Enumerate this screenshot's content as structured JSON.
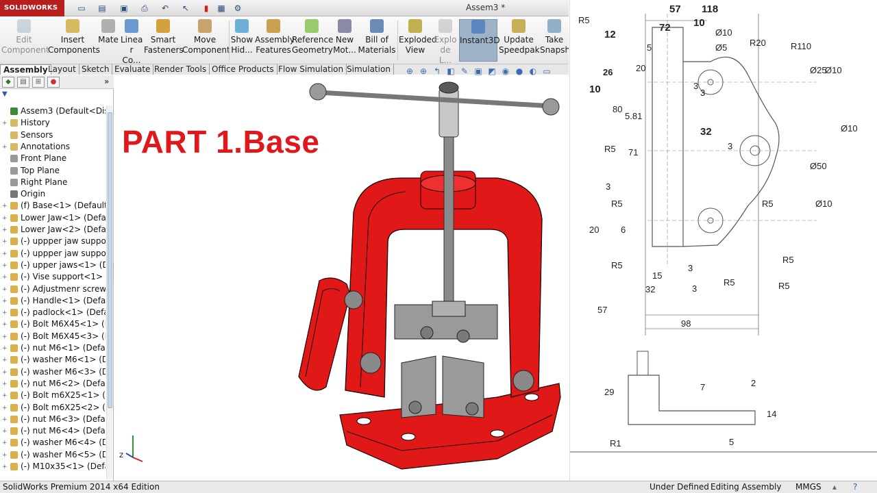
{
  "app": {
    "logo": "SOLIDWORKS",
    "doc_title": "Assem3 *"
  },
  "ribbon": {
    "edit_component": "Edit\nComponent",
    "insert_components": "Insert\nComponents",
    "mate": "Mate",
    "linear": "Linea\nr Co...",
    "smart_fasteners": "Smart\nFasteners",
    "move_component": "Move\nComponent",
    "show_hidden": "Show\nHid...",
    "assembly_features": "Assembly\nFeatures",
    "reference_geometry": "Reference\nGeometry",
    "new_motion": "New\nMot...",
    "bill_of_materials": "Bill of\nMaterials",
    "exploded_view": "Exploded\nView",
    "explode_line": "Explo\nde L...",
    "instant3d": "Instant3D",
    "update_speedpak": "Update\nSpeedpak",
    "take_snapshot": "Take\nSnapsho"
  },
  "tabs": [
    "Assembly",
    "Layout",
    "Sketch",
    "Evaluate",
    "Render Tools",
    "Office Products",
    "Flow Simulation",
    "Simulation"
  ],
  "tree": [
    {
      "label": "Assem3  (Default<Display",
      "expander": ""
    },
    {
      "label": "History",
      "expander": "+"
    },
    {
      "label": "Sensors",
      "expander": ""
    },
    {
      "label": "Annotations",
      "expander": "+"
    },
    {
      "label": "Front Plane",
      "expander": ""
    },
    {
      "label": "Top Plane",
      "expander": ""
    },
    {
      "label": "Right Plane",
      "expander": ""
    },
    {
      "label": "Origin",
      "expander": ""
    },
    {
      "label": "(f) Base<1> (Default<<",
      "expander": "+"
    },
    {
      "label": "Lower Jaw<1> (Default",
      "expander": "+"
    },
    {
      "label": "Lower Jaw<2> (Default",
      "expander": "+"
    },
    {
      "label": "(-) uppper jaw support-",
      "expander": "+"
    },
    {
      "label": "(-) uppper jaw support-",
      "expander": "+"
    },
    {
      "label": "(-) upper jaws<1> (Def",
      "expander": "+"
    },
    {
      "label": "(-) Vise support<1> (De",
      "expander": "+"
    },
    {
      "label": "(-) Adjustmenr screw<1",
      "expander": "+"
    },
    {
      "label": "(-) Handle<1> (Default-",
      "expander": "+"
    },
    {
      "label": "(-) padlock<1> (Default",
      "expander": "+"
    },
    {
      "label": "(-) Bolt M6X45<1> (Def",
      "expander": "+"
    },
    {
      "label": "(-) Bolt M6X45<3> (Def",
      "expander": "+"
    },
    {
      "label": "(-) nut M6<1> (Default-",
      "expander": "+"
    },
    {
      "label": "(-) washer M6<1> (Defa",
      "expander": "+"
    },
    {
      "label": "(-) washer M6<3> (Defa",
      "expander": "+"
    },
    {
      "label": "(-) nut M6<2> (Default-",
      "expander": "+"
    },
    {
      "label": "(-) Bolt m6X25<1> (Def",
      "expander": "+"
    },
    {
      "label": "(-) Bolt m6X25<2> (Def",
      "expander": "+"
    },
    {
      "label": "(-) nut M6<3> (Default-",
      "expander": "+"
    },
    {
      "label": "(-) nut M6<4> (Default-",
      "expander": "+"
    },
    {
      "label": "(-) washer M6<4> (Defa",
      "expander": "+"
    },
    {
      "label": "(-) washer M6<5> (Defa",
      "expander": "+"
    },
    {
      "label": "(-) M10x35<1> (Default",
      "expander": "+"
    }
  ],
  "graphics": {
    "overlay_title": "PART 1.Base"
  },
  "drawing": {
    "dims": [
      "57",
      "118",
      "72",
      "10",
      "12",
      "R5",
      "5",
      "Ø10",
      "Ø5",
      "R20",
      "R110",
      "26",
      "20",
      "Ø25",
      "Ø10",
      "10",
      "3",
      "3",
      "R5",
      "80",
      "5.81",
      "32",
      "3",
      "Ø10",
      "R5",
      "71",
      "Ø50",
      "3",
      "R5",
      "R5",
      "Ø10",
      "20",
      "6",
      "3",
      "R5",
      "R5",
      "15",
      "3",
      "R5",
      "32",
      "57",
      "98",
      "29",
      "7",
      "2",
      "14",
      "R1",
      "5"
    ]
  },
  "status": {
    "edition": "SolidWorks Premium 2014 x64 Edition",
    "state": "Under Defined",
    "mode": "Editing Assembly",
    "units": "MMGS"
  },
  "colors": {
    "accent_red": "#e0181b",
    "brand_red": "#b91e1e"
  }
}
